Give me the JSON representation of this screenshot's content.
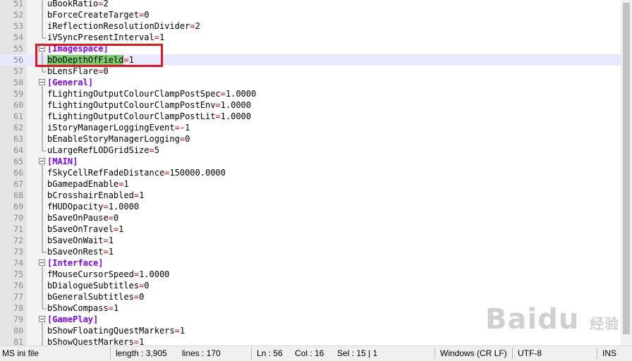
{
  "editor": {
    "lines": [
      {
        "num": "51",
        "indent": "",
        "key": "uBookRatio",
        "eq": "=",
        "val": "2"
      },
      {
        "num": "52",
        "indent": "",
        "key": "bForceCreateTarget",
        "eq": "=",
        "val": "0"
      },
      {
        "num": "53",
        "indent": "",
        "key": "iReflectionResolutionDivider",
        "eq": "=",
        "val": "2"
      },
      {
        "num": "54",
        "indent": "",
        "key": "iVSyncPresentInterval",
        "eq": "=",
        "val": "1"
      },
      {
        "num": "55",
        "indent": "",
        "section": "[Imagespace]"
      },
      {
        "num": "56",
        "indent": "",
        "key": "bDoDepthOfField",
        "eq": "=",
        "val": "1",
        "selected": true
      },
      {
        "num": "57",
        "indent": "",
        "key": "bLensFlare",
        "eq": "=",
        "val": "0"
      },
      {
        "num": "58",
        "indent": "",
        "section": "[General]"
      },
      {
        "num": "59",
        "indent": "",
        "key": "fLightingOutputColourClampPostSpec",
        "eq": "=",
        "val": "1.0000"
      },
      {
        "num": "60",
        "indent": "",
        "key": "fLightingOutputColourClampPostEnv",
        "eq": "=",
        "val": "1.0000"
      },
      {
        "num": "61",
        "indent": "",
        "key": "fLightingOutputColourClampPostLit",
        "eq": "=",
        "val": "1.0000"
      },
      {
        "num": "62",
        "indent": "",
        "key": "iStoryManagerLoggingEvent",
        "eq": "=",
        "val": "-1"
      },
      {
        "num": "63",
        "indent": "",
        "key": "bEnableStoryManagerLogging",
        "eq": "=",
        "val": "0"
      },
      {
        "num": "64",
        "indent": "",
        "key": "uLargeRefLODGridSize",
        "eq": "=",
        "val": "5"
      },
      {
        "num": "65",
        "indent": "",
        "section": "[MAIN]"
      },
      {
        "num": "66",
        "indent": "",
        "key": "fSkyCellRefFadeDistance",
        "eq": "=",
        "val": "150000.0000"
      },
      {
        "num": "67",
        "indent": "",
        "key": "bGamepadEnable",
        "eq": "=",
        "val": "1"
      },
      {
        "num": "68",
        "indent": "",
        "key": "bCrosshairEnabled",
        "eq": "=",
        "val": "1"
      },
      {
        "num": "69",
        "indent": "",
        "key": "fHUDOpacity",
        "eq": "=",
        "val": "1.0000"
      },
      {
        "num": "70",
        "indent": "",
        "key": "bSaveOnPause",
        "eq": "=",
        "val": "0"
      },
      {
        "num": "71",
        "indent": "",
        "key": "bSaveOnTravel",
        "eq": "=",
        "val": "1"
      },
      {
        "num": "72",
        "indent": "",
        "key": "bSaveOnWait",
        "eq": "=",
        "val": "1"
      },
      {
        "num": "73",
        "indent": "",
        "key": "bSaveOnRest",
        "eq": "=",
        "val": "1"
      },
      {
        "num": "74",
        "indent": "",
        "section": "[Interface]"
      },
      {
        "num": "75",
        "indent": "",
        "key": "fMouseCursorSpeed",
        "eq": "=",
        "val": "1.0000"
      },
      {
        "num": "76",
        "indent": "",
        "key": "bDialogueSubtitles",
        "eq": "=",
        "val": "0"
      },
      {
        "num": "77",
        "indent": "",
        "key": "bGeneralSubtitles",
        "eq": "=",
        "val": "0"
      },
      {
        "num": "78",
        "indent": "",
        "key": "bShowCompass",
        "eq": "=",
        "val": "1"
      },
      {
        "num": "79",
        "indent": "",
        "section": "[GamePlay]"
      },
      {
        "num": "80",
        "indent": "",
        "key": "bShowFloatingQuestMarkers",
        "eq": "=",
        "val": "1"
      },
      {
        "num": "81",
        "indent": "",
        "key": "bShowQuestMarkers",
        "eq": "=",
        "val": "1"
      }
    ]
  },
  "statusbar": {
    "language": "MS ini file",
    "length": "length : 3,905",
    "lines": "lines : 170",
    "ln": "Ln : 56",
    "col": "Col : 16",
    "sel": "Sel : 15 | 1",
    "eol": "Windows (CR LF)",
    "encoding": "UTF-8",
    "mode": "INS"
  },
  "watermark": {
    "logo_text": "Baidu",
    "logo_cn": "经验"
  },
  "colors": {
    "section": "#8000ff",
    "operator": "#ff0000",
    "highlight": "#7ccd6c",
    "current_line": "#e8e8ff",
    "annotation_box": "#e8141c"
  }
}
